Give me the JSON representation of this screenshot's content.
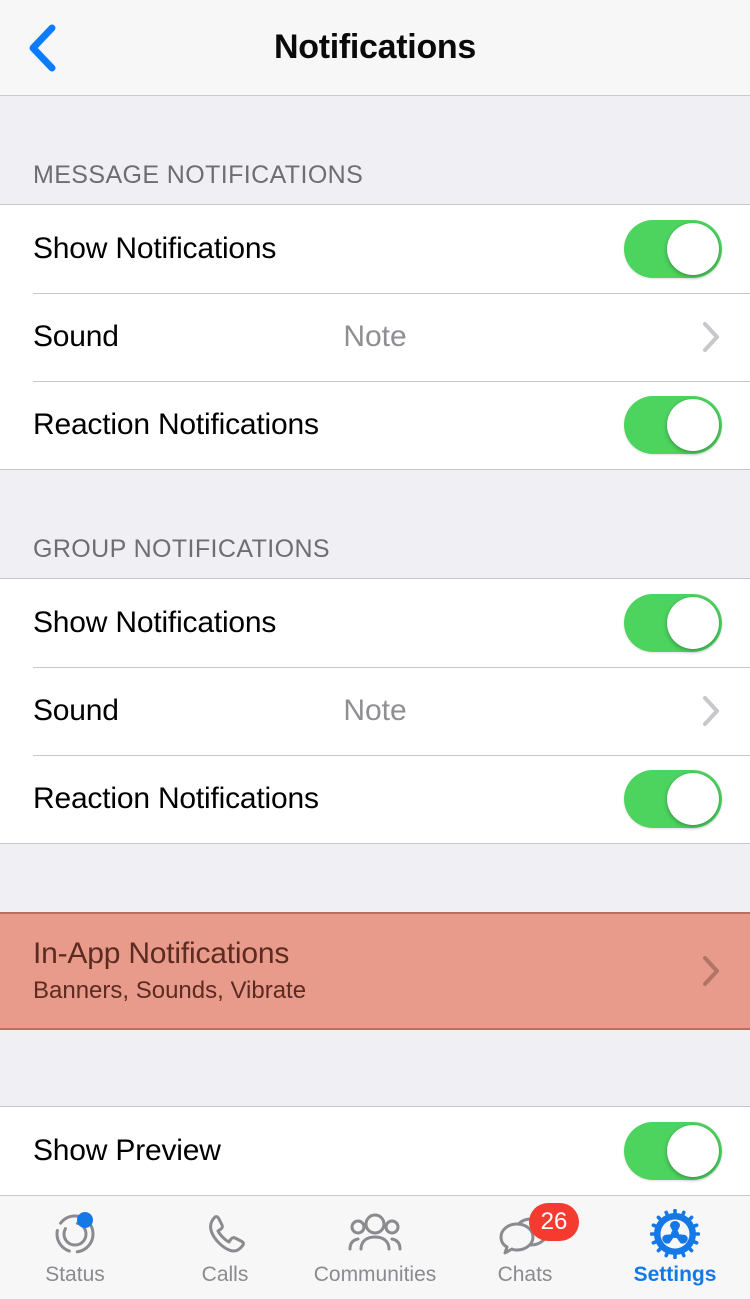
{
  "navbar": {
    "back_icon": "chevron-left-icon",
    "title": "Notifications",
    "accent_color": "#0A7CFF"
  },
  "sections": [
    {
      "header": "MESSAGE NOTIFICATIONS",
      "rows": [
        {
          "label": "Show Notifications",
          "type": "toggle",
          "value": "on"
        },
        {
          "label": "Sound",
          "type": "disclosure",
          "value": "Note"
        },
        {
          "label": "Reaction Notifications",
          "type": "toggle",
          "value": "on"
        }
      ]
    },
    {
      "header": "GROUP NOTIFICATIONS",
      "rows": [
        {
          "label": "Show Notifications",
          "type": "toggle",
          "value": "on"
        },
        {
          "label": "Sound",
          "type": "disclosure",
          "value": "Note"
        },
        {
          "label": "Reaction Notifications",
          "type": "toggle",
          "value": "on"
        }
      ]
    }
  ],
  "highlighted_row": {
    "title": "In-App Notifications",
    "subtitle": "Banners, Sounds, Vibrate",
    "type": "disclosure",
    "highlight_color": "#E89B8A",
    "highlight_border_color": "#B9705F",
    "text_color": "#5B2B22"
  },
  "last_section": {
    "rows": [
      {
        "label": "Show Preview",
        "type": "toggle",
        "value": "on"
      }
    ]
  },
  "colors": {
    "toggle_on": "#4CD45F",
    "section_background": "#EFEFF4",
    "row_background": "#FFFFFF",
    "separator": "#C8C7CC",
    "secondary_text": "#8E8E93",
    "badge_red": "#F53B30",
    "tab_active": "#1479E6"
  },
  "tabbar": {
    "items": [
      {
        "label": "Status",
        "icon": "status-ring-icon",
        "active": false,
        "badge_dot": true
      },
      {
        "label": "Calls",
        "icon": "phone-icon",
        "active": false
      },
      {
        "label": "Communities",
        "icon": "communities-icon",
        "active": false
      },
      {
        "label": "Chats",
        "icon": "chat-bubbles-icon",
        "active": false,
        "badge_count": "26"
      },
      {
        "label": "Settings",
        "icon": "gear-icon",
        "active": true
      }
    ]
  }
}
